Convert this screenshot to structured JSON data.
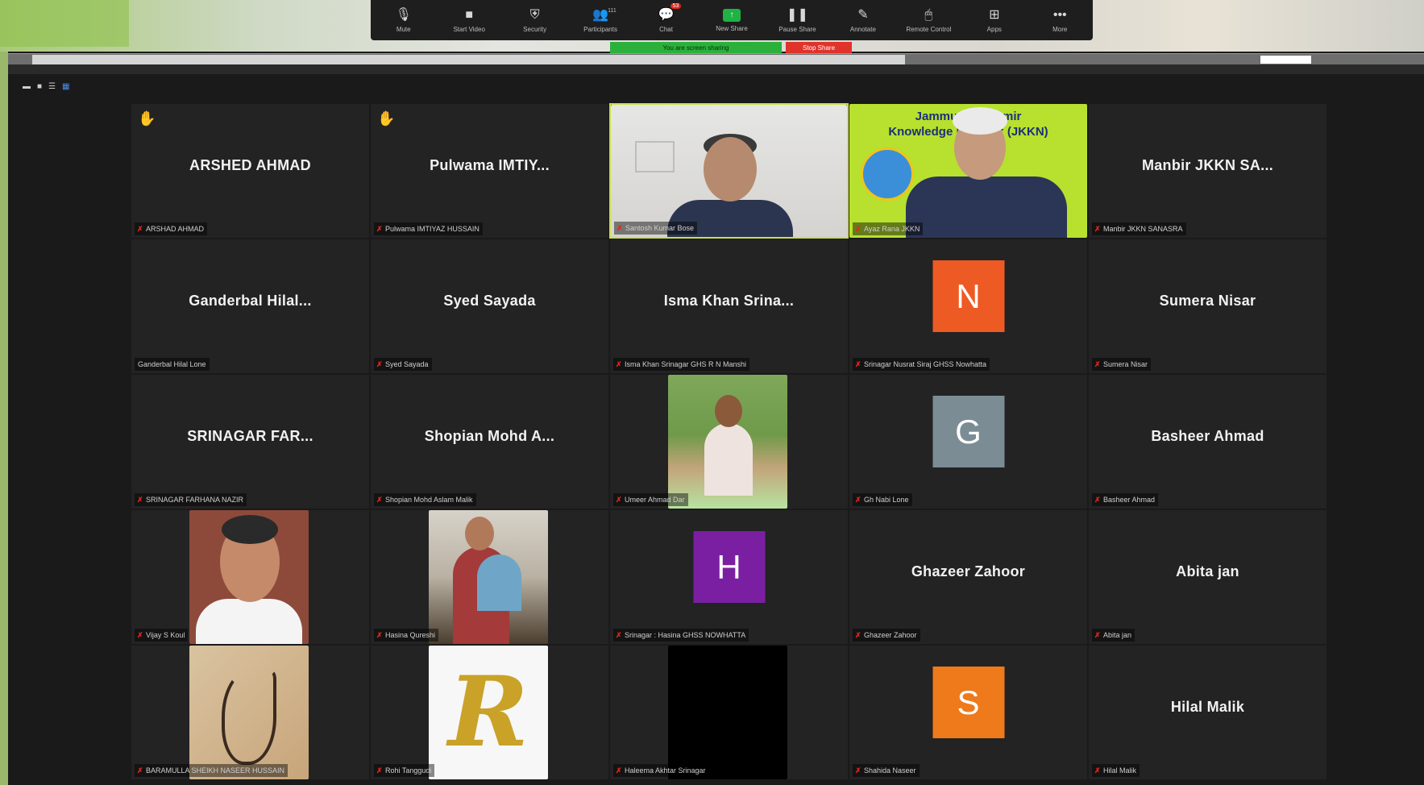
{
  "toolbar": {
    "items": [
      {
        "label": "Mute",
        "icon": "microphone-icon"
      },
      {
        "label": "Start Video",
        "icon": "video-camera-icon"
      },
      {
        "label": "Security",
        "icon": "shield-icon"
      },
      {
        "label": "Participants",
        "icon": "participants-icon",
        "count": "111"
      },
      {
        "label": "Chat",
        "icon": "chat-icon",
        "badge": "53"
      },
      {
        "label": "New Share",
        "icon": "share-screen-icon"
      },
      {
        "label": "Pause Share",
        "icon": "pause-icon"
      },
      {
        "label": "Annotate",
        "icon": "pen-icon"
      },
      {
        "label": "Remote Control",
        "icon": "mouse-icon"
      },
      {
        "label": "Apps",
        "icon": "apps-icon"
      },
      {
        "label": "More",
        "icon": "more-icon"
      }
    ],
    "share_status": "You are screen sharing",
    "stop_share": "Stop Share"
  },
  "gallery": {
    "tiles": [
      {
        "big": "ARSHED AHMAD",
        "label": "ARSHAD AHMAD",
        "hand": true
      },
      {
        "big": "Pulwama IMTIY...",
        "label": "Pulwama IMTIYAZ HUSSAIN",
        "hand": true
      },
      {
        "video": "speaker",
        "label": "Santosh Kumar Bose"
      },
      {
        "video": "jkkn",
        "label": "Ayaz Rana JKKN",
        "banner": "Jammu & Kashmir\nKnowledge Network (JKKN)"
      },
      {
        "big": "Manbir JKKN SA...",
        "label": "Manbir JKKN SANASRA"
      },
      {
        "big": "Ganderbal Hilal...",
        "label": "Ganderbal Hilal Lone",
        "nomute": true
      },
      {
        "big": "Syed Sayada",
        "label": "Syed Sayada"
      },
      {
        "big": "Isma Khan Srina...",
        "label": "Isma Khan Srinagar GHS R N Manshi"
      },
      {
        "initial": "N",
        "color": "#ee5a24",
        "label": "Srinagar Nusrat Siraj GHSS Nowhatta"
      },
      {
        "big": "Sumera Nisar",
        "label": "Sumera Nisar"
      },
      {
        "big": "SRINAGAR FAR...",
        "label": "SRINAGAR FARHANA NAZIR"
      },
      {
        "big": "Shopian Mohd A...",
        "label": "Shopian Mohd Aslam Malik"
      },
      {
        "photo": "young-man",
        "label": "Umeer Ahmad Dar"
      },
      {
        "initial": "G",
        "color": "#7b8c94",
        "label": "Gh Nabi Lone"
      },
      {
        "big": "Basheer Ahmad",
        "label": "Basheer Ahmad"
      },
      {
        "photo": "older-man",
        "label": "Vijay S Koul"
      },
      {
        "photo": "woman-child",
        "label": "Hasina Qureshi"
      },
      {
        "initial": "H",
        "color": "#7b1fa2",
        "label": "Srinagar : Hasina GHSS NOWHATTA"
      },
      {
        "big": "Ghazeer Zahoor",
        "label": "Ghazeer Zahoor"
      },
      {
        "big": "Abita jan",
        "label": "Abita jan"
      },
      {
        "photo": "calligraphy",
        "label": "BARAMULLA SHEIKH NASEER HUSSAIN"
      },
      {
        "photo": "letter-r",
        "label": "Rohi Tanggudi"
      },
      {
        "photo": "black",
        "label": "Haleema Akhtar Srinagar"
      },
      {
        "initial": "S",
        "color": "#ee7a1b",
        "label": "Shahida Naseer"
      },
      {
        "big": "Hilal Malik",
        "label": "Hilal Malik"
      }
    ]
  },
  "colors": {
    "background": "#1a1a1a",
    "tile": "#232323",
    "active_speaker_border": "#cbe04a",
    "share_green": "#2bb13b",
    "stop_red": "#e0332a",
    "mute_red": "#e0281b"
  }
}
